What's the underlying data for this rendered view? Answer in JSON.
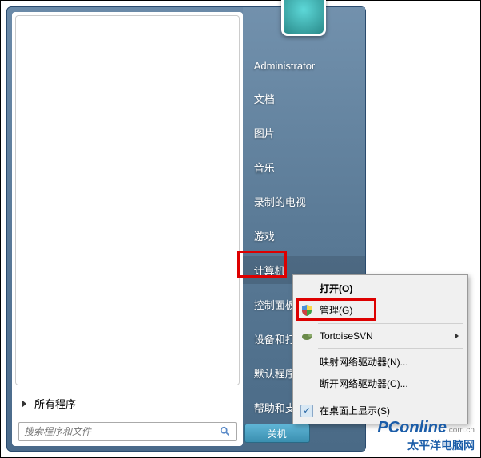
{
  "start_menu": {
    "all_programs": "所有程序",
    "search_placeholder": "搜索程序和文件",
    "shutdown": "关机",
    "right_items": [
      "Administrator",
      "文档",
      "图片",
      "音乐",
      "录制的电视",
      "游戏",
      "计算机",
      "控制面板",
      "设备和打印机",
      "默认程序",
      "帮助和支持"
    ]
  },
  "context_menu": {
    "open": "打开(O)",
    "manage": "管理(G)",
    "tortoise": "TortoiseSVN",
    "map_drive": "映射网络驱动器(N)...",
    "disconnect_drive": "断开网络驱动器(C)...",
    "show_desktop": "在桌面上显示(S)"
  },
  "icons": {
    "shield": "shield-icon",
    "tortoise": "tortoise-icon",
    "check": "check-icon",
    "search": "search-icon",
    "submenu": "chevron-right-icon"
  },
  "watermark": {
    "brand": "PConline",
    "suffix": ".com.cn",
    "name": "太平洋电脑网"
  },
  "highlights": {
    "computer_box": "red",
    "manage_box": "red"
  }
}
